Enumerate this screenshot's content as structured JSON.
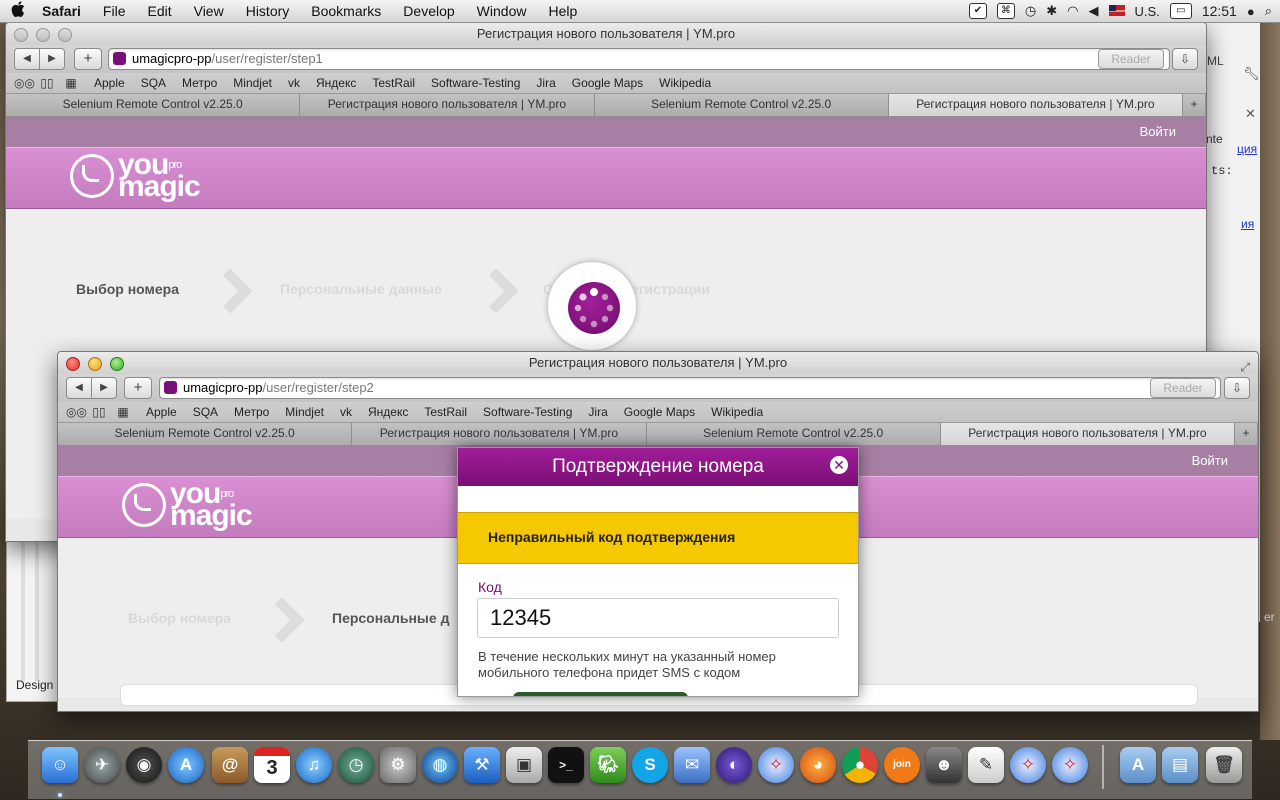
{
  "menubar": {
    "apple": "",
    "items": [
      "Safari",
      "File",
      "Edit",
      "View",
      "History",
      "Bookmarks",
      "Develop",
      "Window",
      "Help"
    ],
    "input_source": "U.S.",
    "clock": "12:51"
  },
  "back_window": {
    "title": "Регистрация нового пользователя | YM.pro",
    "url_host": "umagicpro-pp",
    "url_path": "/user/register/step1",
    "reader": "Reader",
    "bookmarks": [
      "Apple",
      "SQA",
      "Метро",
      "Mindjet",
      "vk",
      "Яндекс",
      "TestRail",
      "Software-Testing",
      "Jira",
      "Google Maps",
      "Wikipedia"
    ],
    "tabs": [
      "Selenium Remote Control v2.25.0",
      "Регистрация нового пользователя | YM.pro",
      "Selenium Remote Control v2.25.0",
      "Регистрация нового пользователя | YM.pro"
    ],
    "login": "Войти",
    "logo_you": "you",
    "logo_magic": "magic",
    "logo_pro": "pro",
    "steps": [
      "Выбор номера",
      "Персональные данные",
      "Окончание регистрации"
    ]
  },
  "front_window": {
    "title": "Регистрация нового пользователя | YM.pro",
    "url_host": "umagicpro-pp",
    "url_path": "/user/register/step2",
    "reader": "Reader",
    "bookmarks": [
      "Apple",
      "SQA",
      "Метро",
      "Mindjet",
      "vk",
      "Яндекс",
      "TestRail",
      "Software-Testing",
      "Jira",
      "Google Maps",
      "Wikipedia"
    ],
    "tabs": [
      "Selenium Remote Control v2.25.0",
      "Регистрация нового пользователя | YM.pro",
      "Selenium Remote Control v2.25.0",
      "Регистрация нового пользователя | YM.pro"
    ],
    "login": "Войти",
    "logo_you": "you",
    "logo_magic": "magic",
    "logo_pro": "pro",
    "steps": [
      "Выбор номера",
      "Персональные д"
    ]
  },
  "modal": {
    "title": "Подтверждение номера",
    "close": "✕",
    "error": "Неправильный код подтверждения",
    "code_label": "Код",
    "code_value": "12345",
    "hint_line1": "В течение нескольких минут на указанный номер",
    "hint_line2": "мобильного телефона придет SMS с кодом"
  },
  "side_fragments": {
    "design": "Design",
    "ml": "ML",
    "nte": "nte",
    "link1": "ция",
    "ts": "ts:",
    "link2": "ия",
    "er": "er"
  },
  "dock": {
    "icons": [
      "finder",
      "launchpad",
      "dashboard",
      "app-store",
      "contacts",
      "calendar",
      "itunes",
      "time-machine",
      "system-preferences",
      "network",
      "xcode",
      "preview",
      "terminal",
      "evernote",
      "skype",
      "mail",
      "eclipse",
      "safari",
      "firefox",
      "chrome",
      "joinme",
      "coda",
      "textedit",
      "safari-2",
      "safari-3",
      "applications",
      "documents",
      "trash"
    ],
    "calendar_day": "3"
  }
}
